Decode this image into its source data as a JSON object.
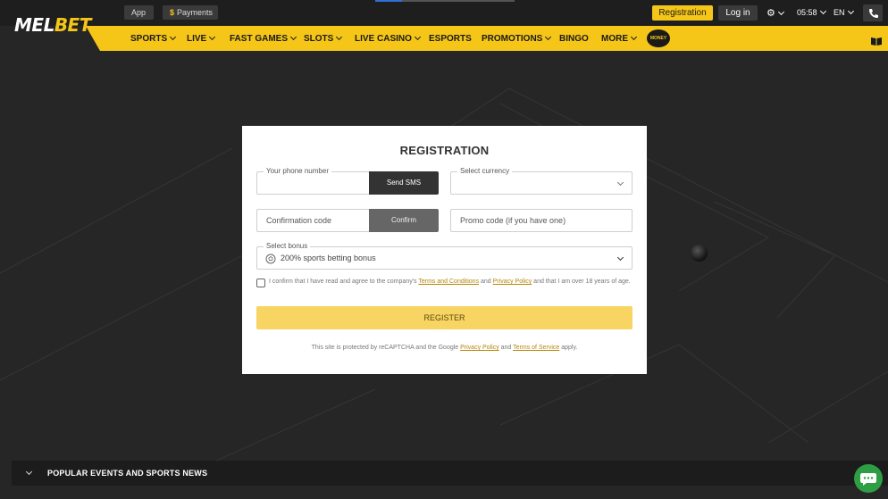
{
  "brand": {
    "logo_main": "MEL",
    "logo_accent": "BET"
  },
  "topbar": {
    "app_label": "App",
    "payments_label": "Payments",
    "payments_icon": "$",
    "registration_label": "Registration",
    "login_label": "Log in",
    "time": "05:58",
    "language": "EN",
    "accent_color": "#f5c518"
  },
  "nav": {
    "items": [
      {
        "label": "SPORTS"
      },
      {
        "label": "LIVE"
      },
      {
        "label": "FAST GAMES"
      },
      {
        "label": "SLOTS"
      },
      {
        "label": "LIVE CASINO"
      },
      {
        "label": "ESPORTS"
      },
      {
        "label": "PROMOTIONS"
      },
      {
        "label": "BINGO"
      },
      {
        "label": "MORE"
      }
    ],
    "money_logo_text": "MONEY"
  },
  "registration": {
    "title": "REGISTRATION",
    "phone_legend": "Your phone number",
    "send_sms_label": "Send SMS",
    "currency_legend": "Select currency",
    "confirmation_placeholder": "Confirmation code",
    "confirm_label": "Confirm",
    "promo_placeholder": "Promo code (if you have one)",
    "bonus_legend": "Select bonus",
    "bonus_value": "200% sports betting bonus",
    "terms_prefix": "I confirm that I have read and agree to the company's ",
    "terms_link": "Terms and Conditions",
    "terms_mid": " and ",
    "privacy_link": "Privacy Policy",
    "terms_suffix": " and that I am over 18 years of age.",
    "register_label": "REGISTER",
    "recaptcha_prefix": "This site is protected by reCAPTCHA and the Google ",
    "recaptcha_privacy": "Privacy Policy",
    "recaptcha_mid": " and ",
    "recaptcha_terms": "Terms of Service",
    "recaptcha_suffix": " apply."
  },
  "bottom": {
    "title": "POPULAR EVENTS AND SPORTS NEWS"
  }
}
